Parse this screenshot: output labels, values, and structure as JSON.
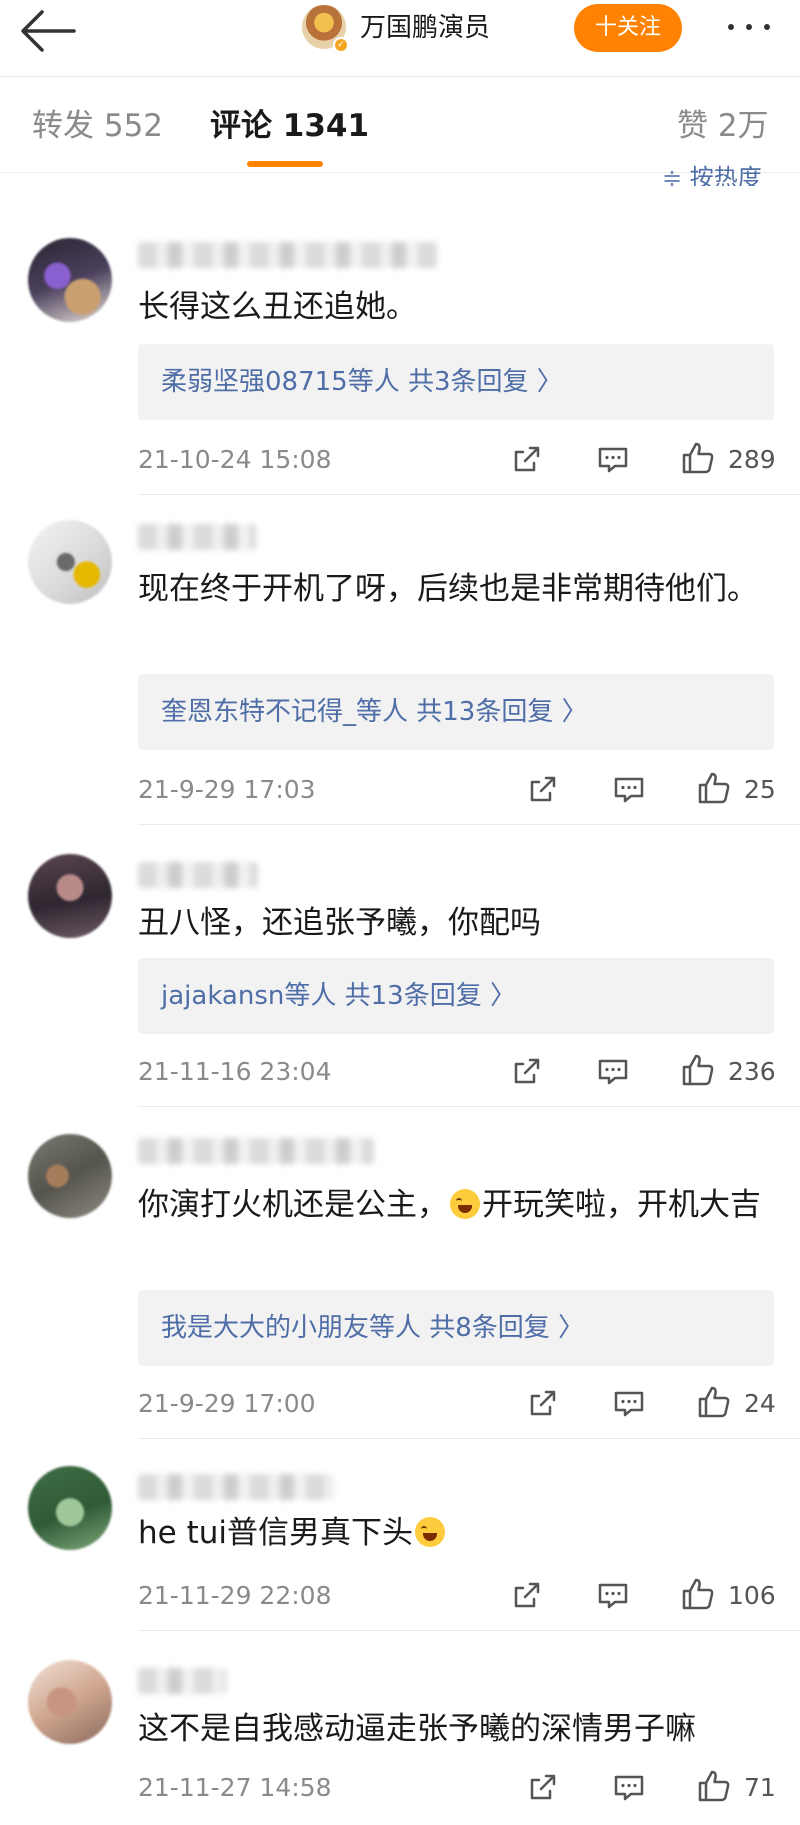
{
  "header": {
    "title": "万国鹏演员",
    "follow_label": "十关注",
    "back_icon": "arrow-left-icon",
    "more_icon": "more-dots-icon"
  },
  "tabs": {
    "repost": "转发 552",
    "comment": "评论 1341",
    "like": "赞 2万",
    "sort": "按热度"
  },
  "colors": {
    "accent": "#ff8200",
    "link": "#4f6ea8",
    "muted": "#8a8a8a"
  },
  "comments": [
    {
      "text": "长得这么丑还追她。",
      "reply_link": "柔弱坚强08715等人  共3条回复 〉",
      "time": "21-10-24 15:08",
      "likes": "289"
    },
    {
      "text": "现在终于开机了呀，后续也是非常期待他们。",
      "reply_link": "奎恩东特不记得_等人  共13条回复 〉",
      "time": "21-9-29 17:03",
      "likes": "25"
    },
    {
      "text": "丑八怪，还追张予曦，你配吗",
      "reply_link": "jajakansn等人  共13条回复 〉",
      "time": "21-11-16 23:04",
      "likes": "236"
    },
    {
      "text_before": "你演打火机还是公主，",
      "text_after": "开玩笑啦，开机大吉",
      "reply_link": "我是大大的小朋友等人  共8条回复 〉",
      "time": "21-9-29 17:00",
      "likes": "24"
    },
    {
      "text": "he tui普信男真下头",
      "time": "21-11-29 22:08",
      "likes": "106"
    },
    {
      "text": "这不是自我感动逼走张予曦的深情男子嘛",
      "time": "21-11-27 14:58",
      "likes": "71"
    }
  ]
}
